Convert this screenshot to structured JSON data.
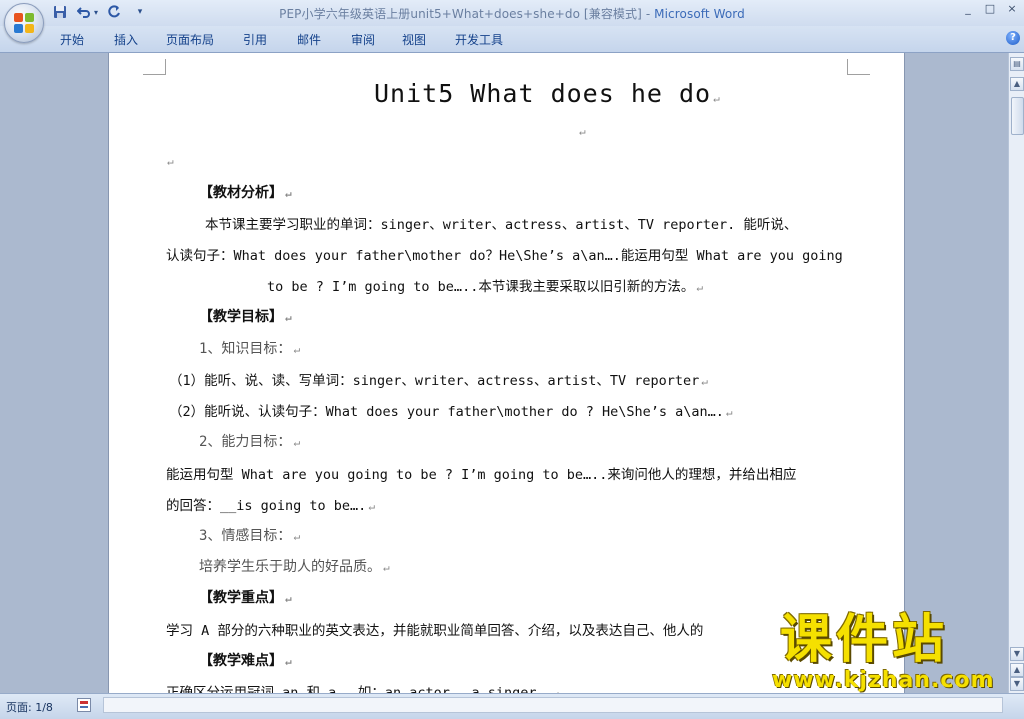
{
  "window": {
    "title_doc": "PEP小学六年级英语上册unit5+What+does+she+do [兼容模式] - ",
    "title_app": "Microsoft Word",
    "controls": [
      "_",
      "□",
      "×"
    ]
  },
  "quick_access": {
    "icons": [
      "save-icon",
      "undo-icon",
      "redo-icon",
      "customize-icon"
    ]
  },
  "ribbon_tabs": [
    "开始",
    "插入",
    "页面布局",
    "引用",
    "邮件",
    "审阅",
    "视图",
    "开发工具"
  ],
  "document": {
    "title": "Unit5 What does he do",
    "para_mark": "↵",
    "lines": [
      "【教材分析】",
      "本节课主要学习职业的单词：singer、writer、actress、artist、TV reporter. 能听说、",
      "认读句子：What does your father\\mother do？He\\She’s a\\an….能运用句型 What are you going",
      "to be ? I’m going to be…..本节课我主要采取以旧引新的方法。",
      "【教学目标】",
      "1、知识目标：",
      "（1）能听、说、读、写单词：singer、writer、actress、artist、TV reporter",
      "（2）能听说、认读句子：What does your father\\mother do ? He\\She’s a\\an….",
      "2、能力目标：",
      "能运用句型 What are you going to be ? I’m going to be…..来询问他人的理想，并给出相应",
      "的回答：__is going to be….",
      "3、情感目标：",
      "培养学生乐于助人的好品质。",
      "【教学重点】",
      "学习 A 部分的六种职业的英文表达，并能就职业简单回答、介绍，以及表达自己、他人的",
      "【教学难点】",
      "正确区分运用冠词 an 和 a ，如：an actor ，a singer，"
    ]
  },
  "status": {
    "page": "页面: 1/8"
  },
  "watermark": {
    "big": "课件站",
    "small": "www.kjzhan.com"
  }
}
